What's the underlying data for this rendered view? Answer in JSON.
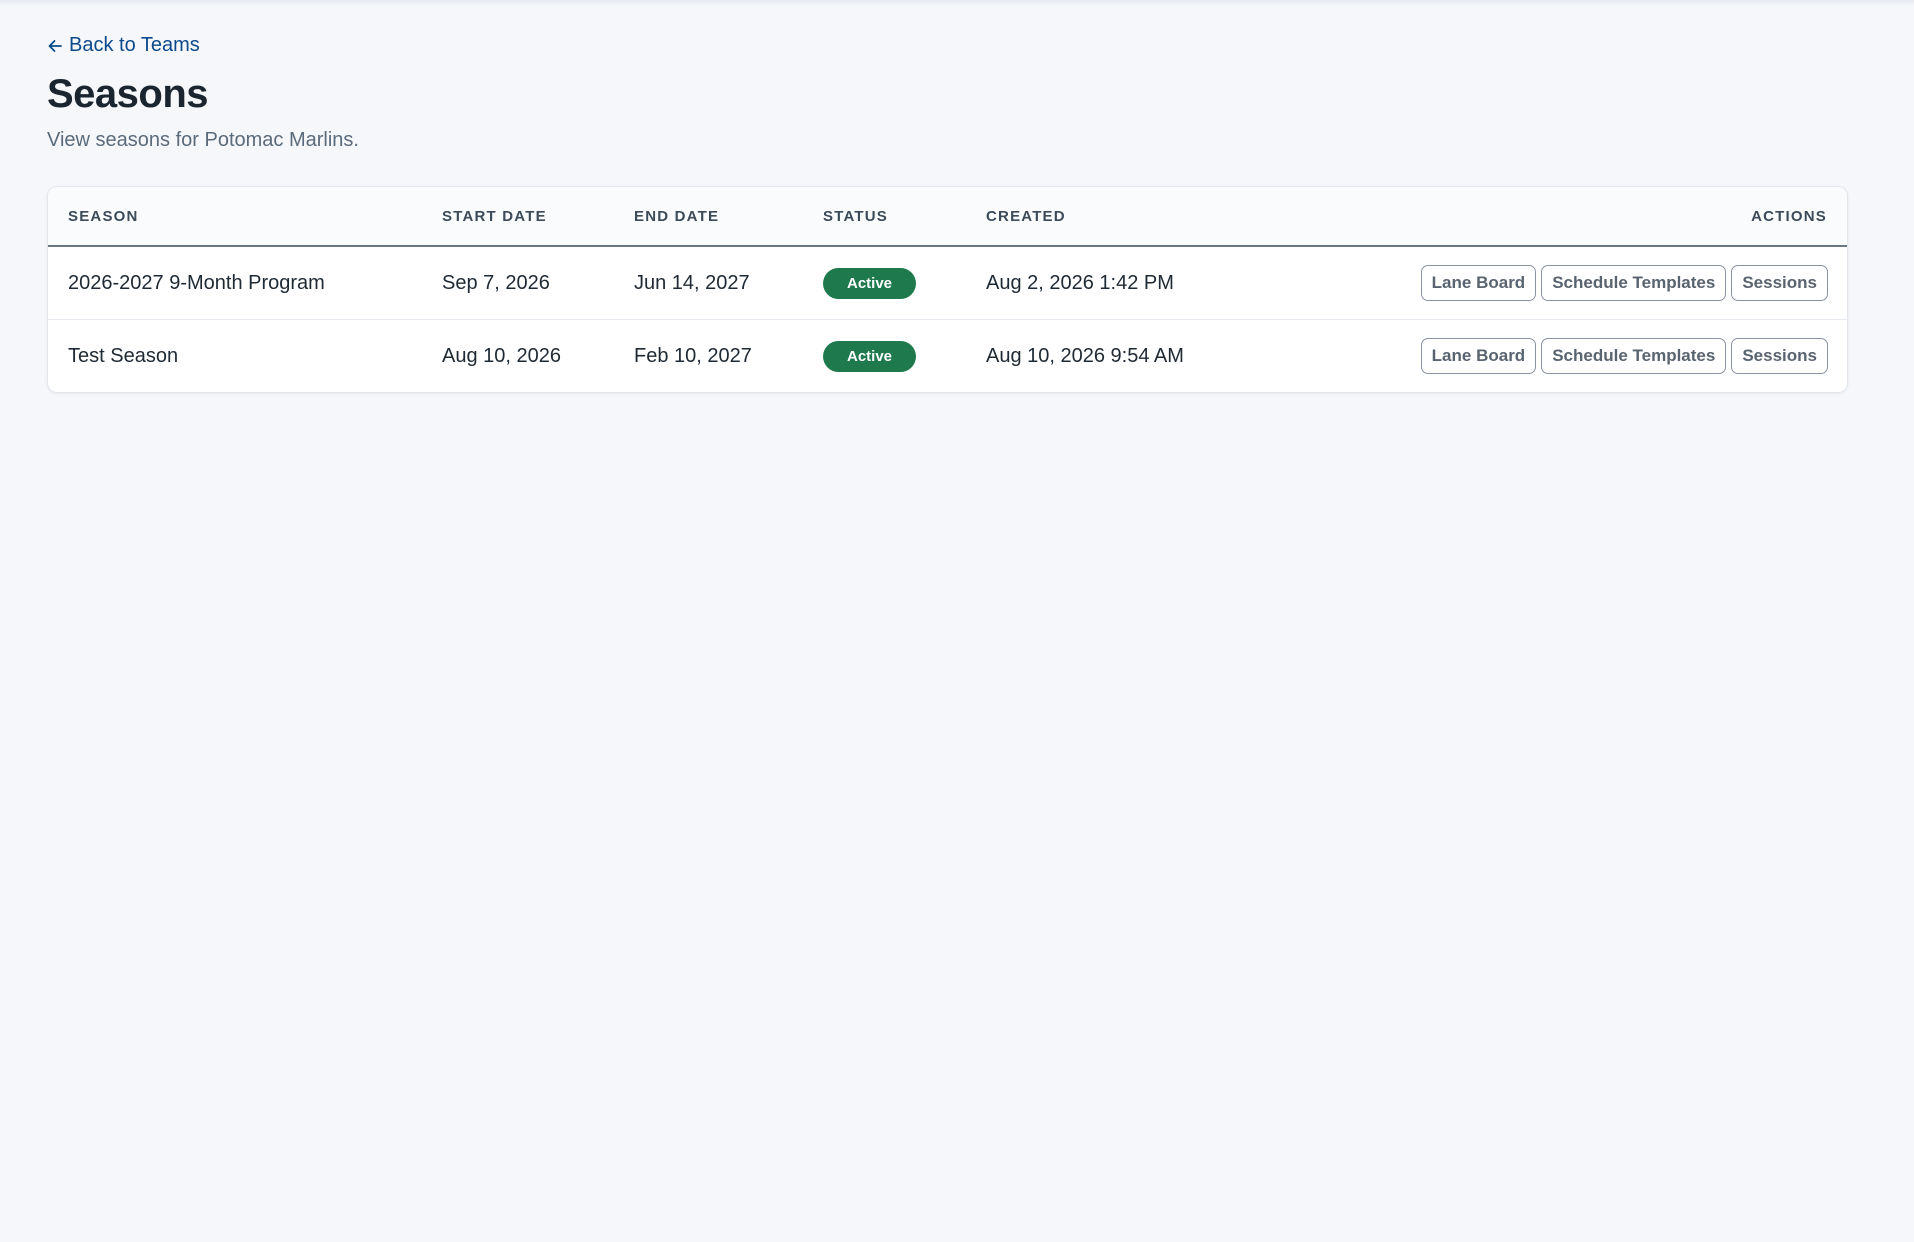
{
  "back_link": {
    "label": "Back to Teams",
    "icon": "arrow-left-icon"
  },
  "header": {
    "title": "Seasons",
    "subtitle": "View seasons for Potomac Marlins."
  },
  "table": {
    "columns": [
      "SEASON",
      "START DATE",
      "END DATE",
      "STATUS",
      "CREATED",
      "ACTIONS"
    ],
    "rows": [
      {
        "season": "2026-2027 9-Month Program",
        "start_date": "Sep 7, 2026",
        "end_date": "Jun 14, 2027",
        "status": "Active",
        "created": "Aug 2, 2026 1:42 PM",
        "actions": [
          "Lane Board",
          "Schedule Templates",
          "Sessions"
        ]
      },
      {
        "season": "Test Season",
        "start_date": "Aug 10, 2026",
        "end_date": "Feb 10, 2027",
        "status": "Active",
        "created": "Aug 10, 2026 9:54 AM",
        "actions": [
          "Lane Board",
          "Schedule Templates",
          "Sessions"
        ]
      }
    ]
  },
  "colors": {
    "background": "#f5f7fa",
    "link": "#0b4a8b",
    "status_active": "#1e7a4c"
  }
}
